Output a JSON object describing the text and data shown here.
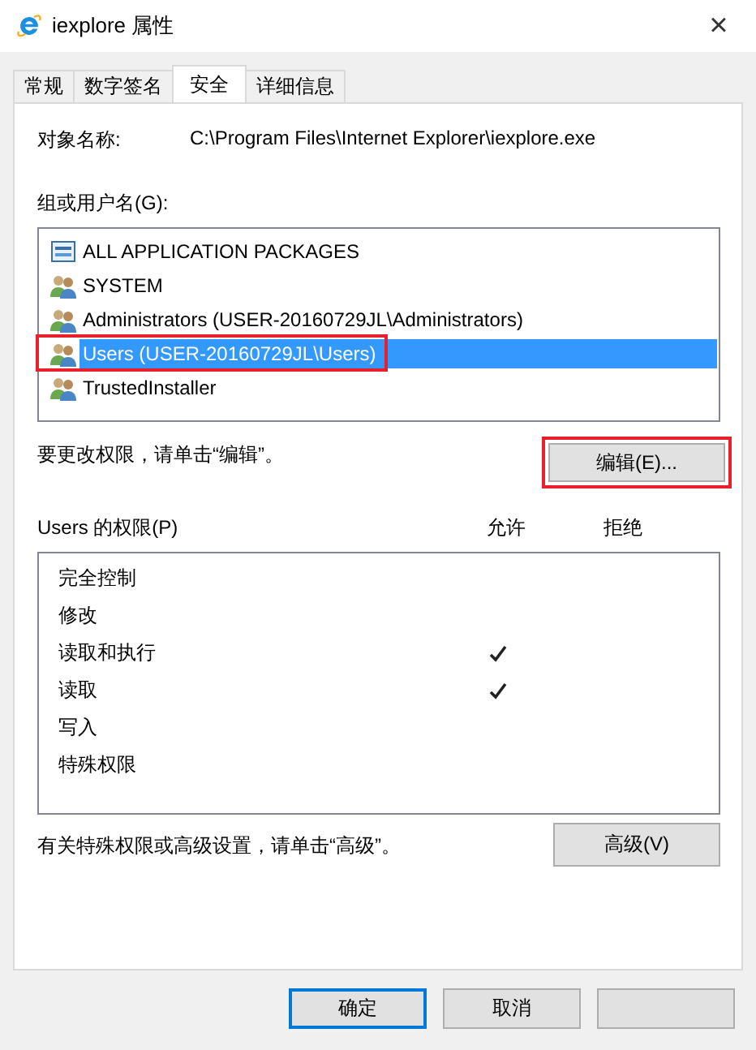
{
  "window": {
    "title": "iexplore 属性",
    "close": "×"
  },
  "tabs": [
    {
      "label": "常规",
      "selected": false
    },
    {
      "label": "数字签名",
      "selected": false
    },
    {
      "label": "安全",
      "selected": true
    },
    {
      "label": "详细信息",
      "selected": false
    }
  ],
  "object_name": {
    "label": "对象名称:",
    "value": "C:\\Program Files\\Internet Explorer\\iexplore.exe"
  },
  "groups": {
    "label": "组或用户名(G):",
    "items": [
      {
        "name": "ALL APPLICATION PACKAGES",
        "kind": "package",
        "selected": false,
        "highlighted": false
      },
      {
        "name": "SYSTEM",
        "kind": "group",
        "selected": false,
        "highlighted": false
      },
      {
        "name": "Administrators (USER-20160729JL\\Administrators)",
        "kind": "group",
        "selected": false,
        "highlighted": false
      },
      {
        "name": "Users (USER-20160729JL\\Users)",
        "kind": "group",
        "selected": true,
        "highlighted": true
      },
      {
        "name": "TrustedInstaller",
        "kind": "group",
        "selected": false,
        "highlighted": false
      }
    ]
  },
  "edit_hint": "要更改权限，请单击“编辑”。",
  "edit_button": {
    "label": "编辑(E)...",
    "highlighted": true
  },
  "permissions": {
    "label": "Users 的权限(P)",
    "allow_header": "允许",
    "deny_header": "拒绝",
    "rows": [
      {
        "name": "完全控制",
        "allow": false,
        "deny": false
      },
      {
        "name": "修改",
        "allow": false,
        "deny": false
      },
      {
        "name": "读取和执行",
        "allow": true,
        "deny": false
      },
      {
        "name": "读取",
        "allow": true,
        "deny": false
      },
      {
        "name": "写入",
        "allow": false,
        "deny": false
      },
      {
        "name": "特殊权限",
        "allow": false,
        "deny": false
      }
    ]
  },
  "advanced_hint": "有关特殊权限或高级设置，请单击“高级”。",
  "advanced_button": "高级(V)",
  "buttons": [
    {
      "kind": "default",
      "label": "确定"
    },
    {
      "kind": "normal",
      "label": "取消"
    },
    {
      "kind": "blank"
    }
  ]
}
